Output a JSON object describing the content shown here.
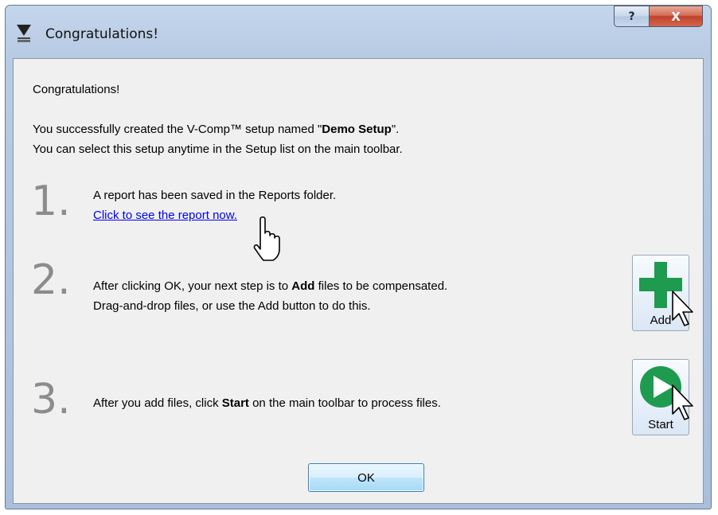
{
  "window": {
    "title": "Congratulations!"
  },
  "caption": {
    "help": "?",
    "close": "X"
  },
  "icons": {
    "app": "v-comp-app-icon",
    "help": "help-icon",
    "close": "close-icon",
    "add": "green-plus-icon",
    "start": "green-play-icon",
    "hand_cursor": "hand-pointer-icon",
    "arrow_cursor": "arrow-pointer-icon"
  },
  "body": {
    "heading": "Congratulations!",
    "line1_pre": "You successfully created the V-Comp™ setup named \"",
    "setup_name": "Demo Setup",
    "line1_post": "\".",
    "line2": "You can select this setup anytime in the Setup list on the main toolbar."
  },
  "steps": {
    "s1": {
      "num": "1.",
      "text": "A report has been saved in the Reports folder.",
      "link": "Click to see the report now."
    },
    "s2": {
      "num": "2.",
      "pre": "After clicking OK, your next step is to ",
      "bold": "Add",
      "post": " files to be compensated.",
      "line2": "Drag-and-drop files, or use the Add button to do this."
    },
    "s3": {
      "num": "3.",
      "pre": "After you add files, click ",
      "bold": "Start",
      "post": " on the main toolbar to process files."
    }
  },
  "buttons": {
    "add": "Add",
    "start": "Start",
    "ok": "OK"
  },
  "colors": {
    "accent_green": "#1e9b4f",
    "link": "#0000ee",
    "step_number": "#8c8c8c"
  }
}
